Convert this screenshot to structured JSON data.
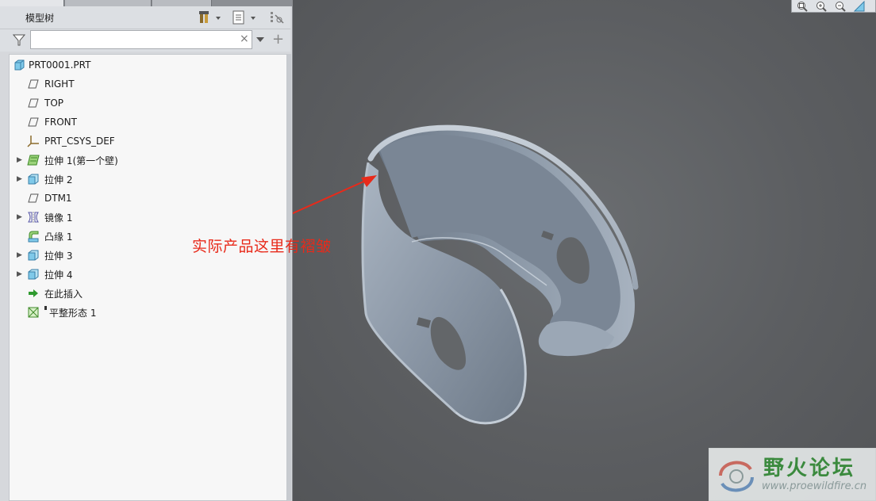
{
  "model_tree": {
    "title": "模型树",
    "filter_placeholder": "",
    "clear_symbol": "×",
    "add_symbol": "+",
    "items": [
      {
        "label": "PRT0001.PRT",
        "icon": "part-icon",
        "expandable": false
      },
      {
        "label": "RIGHT",
        "icon": "datum-plane-icon",
        "expandable": false
      },
      {
        "label": "TOP",
        "icon": "datum-plane-icon",
        "expandable": false
      },
      {
        "label": "FRONT",
        "icon": "datum-plane-icon",
        "expandable": false
      },
      {
        "label": "PRT_CSYS_DEF",
        "icon": "coordinate-system-icon",
        "expandable": false
      },
      {
        "label": "拉伸 1(第一个壁)",
        "icon": "sheetmetal-wall-icon",
        "expandable": true
      },
      {
        "label": "拉伸 2",
        "icon": "extrude-icon",
        "expandable": true
      },
      {
        "label": "DTM1",
        "icon": "datum-plane-icon",
        "expandable": false
      },
      {
        "label": "镜像 1",
        "icon": "mirror-icon",
        "expandable": true
      },
      {
        "label": "凸缘 1",
        "icon": "flange-icon",
        "expandable": false
      },
      {
        "label": "拉伸 3",
        "icon": "extrude-icon",
        "expandable": true
      },
      {
        "label": "拉伸 4",
        "icon": "extrude-icon",
        "expandable": true
      },
      {
        "label": "在此插入",
        "icon": "insert-here-arrow-icon",
        "expandable": false
      },
      {
        "label": "平整形态 1",
        "icon": "flat-state-icon",
        "expandable": false
      }
    ]
  },
  "viewport": {
    "annotation_text": "实际产品这里有褶皱",
    "annotation_color": "#e82a1a"
  },
  "watermark": {
    "title": "野火论坛",
    "url": "www.proewildfire.cn"
  },
  "colors": {
    "viewport_bg": "#5a5c5f",
    "part_surface": "#8d99a8",
    "panel_bg": "#d6d8dc",
    "tree_bg": "#f7f7f7"
  }
}
